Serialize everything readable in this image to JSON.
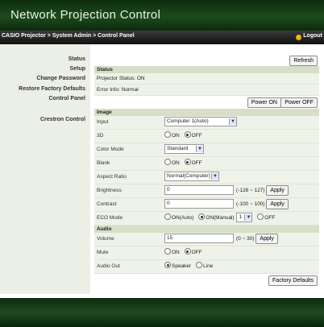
{
  "header": {
    "title": "Network Projection Control"
  },
  "nav": {
    "breadcrumb": "CASIO Projector > System Admin > Control Panel",
    "logout": "Logout"
  },
  "sidebar": {
    "items": [
      "Status",
      "Setup",
      "Change Password",
      "Restore Factory Defaults",
      "Control Panel",
      "Crestron Control"
    ]
  },
  "buttons": {
    "refresh": "Refresh",
    "power_on": "Power ON",
    "power_off": "Power OFF",
    "apply": "Apply",
    "factory_defaults": "Factory Defaults"
  },
  "status": {
    "heading": "Status",
    "projector_status": "Projector Status: ON",
    "error_info": "Error Info: Normal"
  },
  "image": {
    "heading": "Image",
    "input_label": "Input",
    "input_value": "Computer 1(Auto)",
    "three_d_label": "3D",
    "color_mode_label": "Color Mode",
    "color_mode_value": "Standard",
    "blank_label": "Blank",
    "aspect_label": "Aspect Ratio",
    "aspect_value": "Normal(Computer)",
    "brightness_label": "Brightness",
    "brightness_value": "0",
    "brightness_range": "(-128 ~ 127)",
    "contrast_label": "Contrast",
    "contrast_value": "0",
    "contrast_range": "(-100 ~ 100)",
    "eco_label": "ECO Mode",
    "eco_auto": "ON(Auto)",
    "eco_manual": "ON(Manual)",
    "eco_level": "1",
    "eco_off": "OFF"
  },
  "audio": {
    "heading": "Audio",
    "volume_label": "Volume",
    "volume_value": "15",
    "volume_range": "(0 ~ 30)",
    "mute_label": "Mute",
    "out_label": "Audio Out",
    "out_speaker": "Speaker",
    "out_line": "Line"
  },
  "radio": {
    "on": "ON",
    "off": "OFF"
  },
  "colors": {
    "header_bg": "#1d4a1d",
    "navbar_bg": "#222222",
    "section_bg": "#d6dec8",
    "row_bg": "#eef2e8",
    "sidebar_bg": "#ecefe6"
  }
}
